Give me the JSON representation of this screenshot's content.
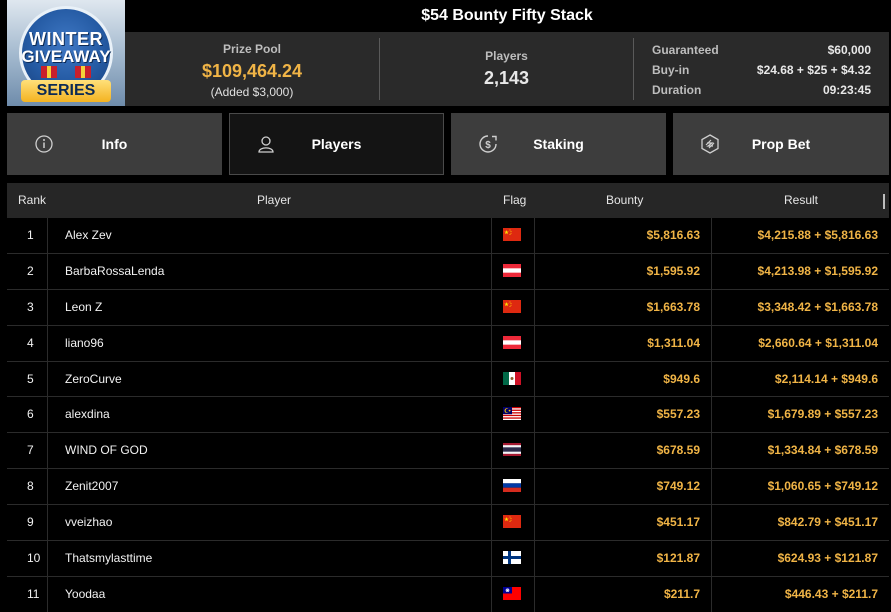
{
  "header": {
    "logo": {
      "line1": "WINTER",
      "line2": "GIVEAWAY",
      "line3": "SERIES"
    },
    "title": "$54 Bounty Fifty Stack",
    "prize_pool": {
      "label": "Prize Pool",
      "value": "$109,464.24",
      "added": "(Added $3,000)"
    },
    "players": {
      "label": "Players",
      "value": "2,143"
    },
    "details": [
      {
        "label": "Guaranteed",
        "value": "$60,000"
      },
      {
        "label": "Buy-in",
        "value": "$24.68 + $25 + $4.32"
      },
      {
        "label": "Duration",
        "value": "09:23:45"
      }
    ]
  },
  "tabs": [
    {
      "label": "Info",
      "icon": "info-icon",
      "active": false
    },
    {
      "label": "Players",
      "icon": "user-icon",
      "active": true
    },
    {
      "label": "Staking",
      "icon": "dollar-coin-icon",
      "active": false
    },
    {
      "label": "Prop Bet",
      "icon": "prop-bet-icon",
      "active": false
    }
  ],
  "table": {
    "columns": [
      "Rank",
      "Player",
      "Flag",
      "Bounty",
      "Result"
    ],
    "rows": [
      {
        "rank": "1",
        "player": "Alex Zev",
        "flag": "china",
        "bounty": "$5,816.63",
        "result": "$4,215.88 + $5,816.63"
      },
      {
        "rank": "2",
        "player": "BarbaRossaLenda",
        "flag": "austria",
        "bounty": "$1,595.92",
        "result": "$4,213.98 + $1,595.92"
      },
      {
        "rank": "3",
        "player": "Leon Z",
        "flag": "china",
        "bounty": "$1,663.78",
        "result": "$3,348.42 + $1,663.78"
      },
      {
        "rank": "4",
        "player": "liano96",
        "flag": "austria",
        "bounty": "$1,311.04",
        "result": "$2,660.64 + $1,311.04"
      },
      {
        "rank": "5",
        "player": "ZeroCurve",
        "flag": "mexico",
        "bounty": "$949.6",
        "result": "$2,114.14 + $949.6"
      },
      {
        "rank": "6",
        "player": "alexdina",
        "flag": "malaysia",
        "bounty": "$557.23",
        "result": "$1,679.89 + $557.23"
      },
      {
        "rank": "7",
        "player": "WIND OF GOD",
        "flag": "thailand",
        "bounty": "$678.59",
        "result": "$1,334.84 + $678.59"
      },
      {
        "rank": "8",
        "player": "Zenit2007",
        "flag": "russia",
        "bounty": "$749.12",
        "result": "$1,060.65 + $749.12"
      },
      {
        "rank": "9",
        "player": "vveizhao",
        "flag": "china",
        "bounty": "$451.17",
        "result": "$842.79 + $451.17"
      },
      {
        "rank": "10",
        "player": "Thatsmylasttime",
        "flag": "finland",
        "bounty": "$121.87",
        "result": "$624.93 + $121.87"
      },
      {
        "rank": "11",
        "player": "Yoodaa",
        "flag": "taiwan",
        "bounty": "$211.7",
        "result": "$446.43 + $211.7"
      }
    ]
  },
  "colors": {
    "accent": "#f0b446",
    "panel": "#2a2a2a",
    "tab": "#3d3d3d",
    "tab_active": "#141414"
  }
}
